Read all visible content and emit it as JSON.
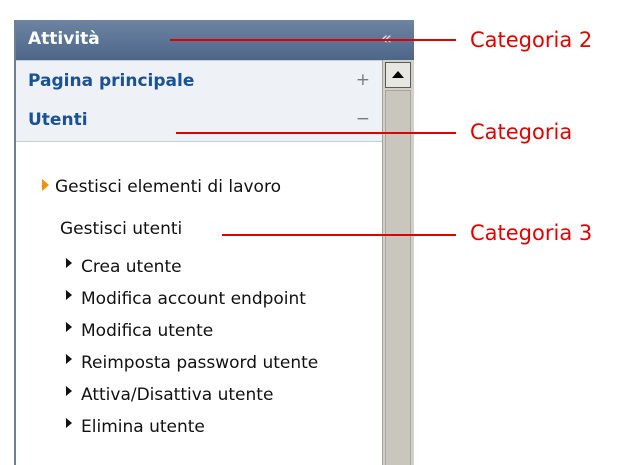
{
  "panel": {
    "title": "Attività",
    "collapse_glyph": "«",
    "categories": [
      {
        "label": "Pagina principale",
        "toggle": "+"
      },
      {
        "label": "Utenti",
        "toggle": "−"
      }
    ],
    "items": [
      {
        "label": "Gestisci elementi di lavoro"
      },
      {
        "label": "Gestisci utenti"
      },
      {
        "label": "Crea utente"
      },
      {
        "label": "Modifica account endpoint"
      },
      {
        "label": "Modifica utente"
      },
      {
        "label": "Reimposta password utente"
      },
      {
        "label": "Attiva/Disattiva utente"
      },
      {
        "label": "Elimina utente"
      }
    ]
  },
  "callouts": [
    {
      "text": "Categoria 2"
    },
    {
      "text": "Categoria"
    },
    {
      "text": "Categoria 3"
    }
  ],
  "colors": {
    "titlebar": "#5b7396",
    "category_text": "#1a5296",
    "callout": "#e10000",
    "active_arrow": "#f0900e"
  },
  "icons": {
    "collapse": "double-chevron-left-icon",
    "expand": "plus-icon",
    "collapse_category": "minus-icon"
  }
}
